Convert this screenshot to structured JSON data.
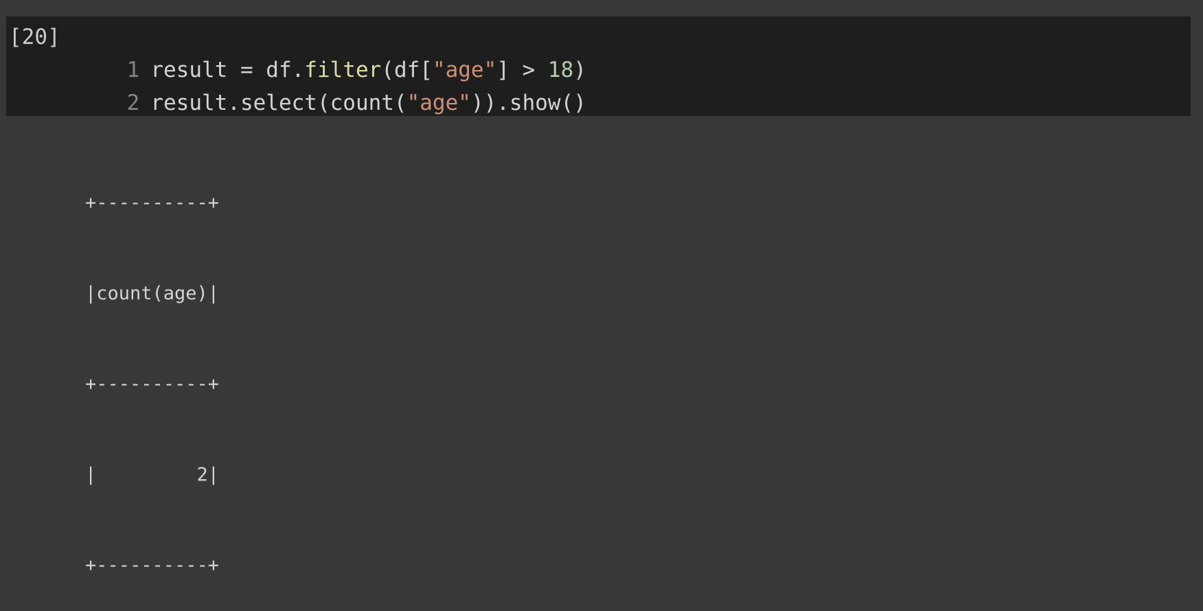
{
  "cell": {
    "execution_count": "[20]",
    "lines": [
      {
        "number": "1",
        "tokens": [
          {
            "text": "result = df.",
            "kind": "plain"
          },
          {
            "text": "filter",
            "kind": "fn"
          },
          {
            "text": "(df[",
            "kind": "plain"
          },
          {
            "text": "\"age\"",
            "kind": "str"
          },
          {
            "text": "] > ",
            "kind": "plain"
          },
          {
            "text": "18",
            "kind": "num"
          },
          {
            "text": ")",
            "kind": "plain"
          }
        ]
      },
      {
        "number": "2",
        "tokens": [
          {
            "text": "result.select(count(",
            "kind": "plain"
          },
          {
            "text": "\"age\"",
            "kind": "str"
          },
          {
            "text": ")).show()",
            "kind": "plain"
          }
        ]
      }
    ]
  },
  "output": {
    "lines": [
      "+----------+",
      "|count(age)|",
      "+----------+",
      "|         2|",
      "+----------+"
    ]
  },
  "colors": {
    "page_background": "#383838",
    "cell_background": "#1e1e1e",
    "text": "#d4d4d4",
    "line_number": "#858585",
    "function": "#dcdcaa",
    "string": "#ce9178",
    "number": "#b5cea8"
  }
}
